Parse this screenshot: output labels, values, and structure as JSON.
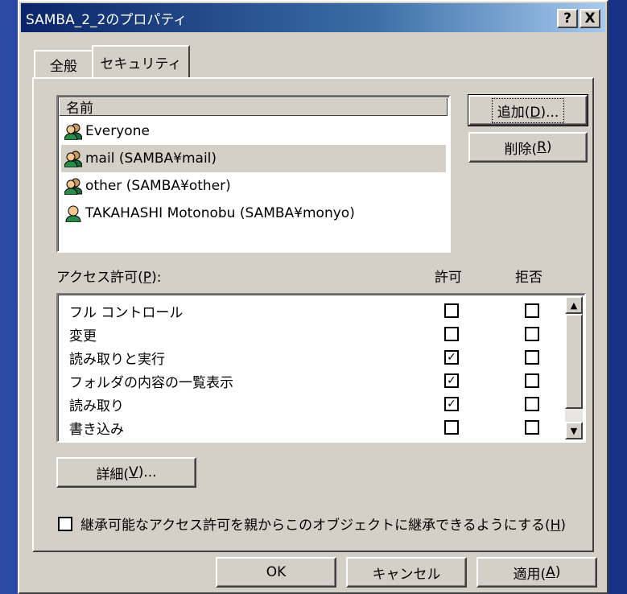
{
  "window": {
    "title": "SAMBA_2_2のプロパティ",
    "help_label": "?",
    "close_label": "X"
  },
  "tabs": [
    {
      "label": "全般"
    },
    {
      "label": "セキュリティ"
    }
  ],
  "users": {
    "column_header": "名前",
    "items": [
      {
        "label": "Everyone",
        "icon": "group-icon"
      },
      {
        "label": "mail (SAMBA¥mail)",
        "icon": "group-icon",
        "selected": true
      },
      {
        "label": "other (SAMBA¥other)",
        "icon": "group-icon"
      },
      {
        "label": "TAKAHASHI Motonobu (SAMBA¥monyo)",
        "icon": "user-icon"
      }
    ]
  },
  "buttons": {
    "add": {
      "text": "追加(",
      "key": "D",
      "suffix": ")..."
    },
    "remove": {
      "text": "削除(",
      "key": "R",
      "suffix": ")"
    },
    "advanced": {
      "text": "詳細(",
      "key": "V",
      "suffix": ")..."
    },
    "ok": "OK",
    "cancel": "キャンセル",
    "apply": {
      "text": "適用(",
      "key": "A",
      "suffix": ")"
    }
  },
  "permissions": {
    "label_text": "アクセス許可(",
    "label_key": "P",
    "label_suffix": "):",
    "allow_header": "許可",
    "deny_header": "拒否",
    "items": [
      {
        "label": "フル コントロール",
        "allow": false,
        "deny": false
      },
      {
        "label": "変更",
        "allow": false,
        "deny": false
      },
      {
        "label": "読み取りと実行",
        "allow": true,
        "deny": false
      },
      {
        "label": "フォルダの内容の一覧表示",
        "allow": true,
        "deny": false
      },
      {
        "label": "読み取り",
        "allow": true,
        "deny": false
      },
      {
        "label": "書き込み",
        "allow": false,
        "deny": false
      }
    ]
  },
  "inherit": {
    "checked": false,
    "text": "継承可能なアクセス許可を親からこのオブジェクトに継承できるようにする(",
    "key": "H",
    "suffix": ")"
  }
}
